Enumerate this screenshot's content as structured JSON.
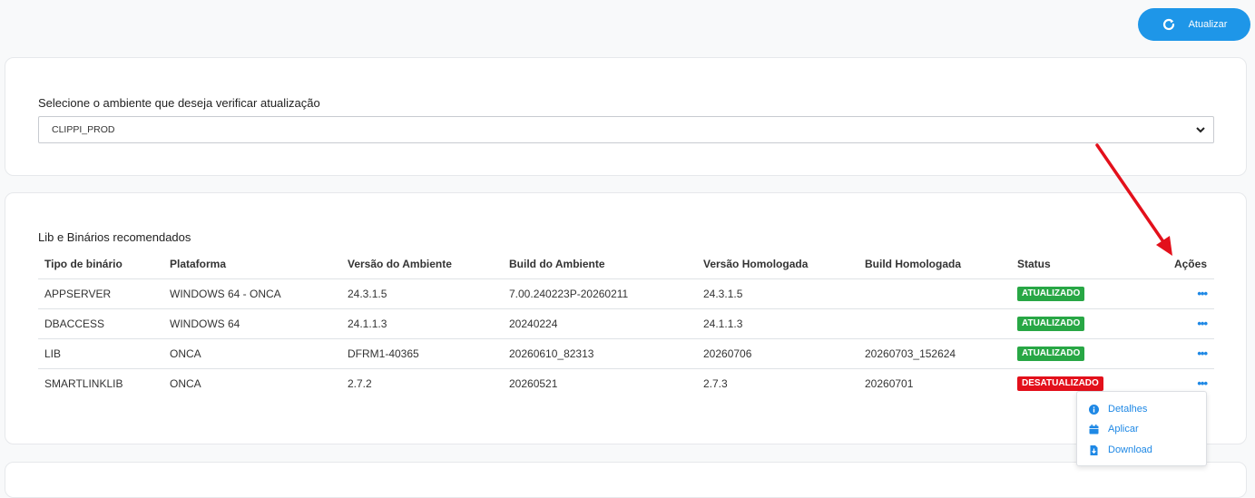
{
  "toolbar": {
    "refresh_label": "Atualizar",
    "refresh_icon": "refresh-icon"
  },
  "environment": {
    "label": "Selecione o ambiente que deseja verificar atualização",
    "selected": "CLIPPI_PROD"
  },
  "binaries": {
    "title": "Lib e Binários recomendados",
    "columns": [
      "Tipo de binário",
      "Plataforma",
      "Versão do Ambiente",
      "Build do Ambiente",
      "Versão Homologada",
      "Build Homologada",
      "Status",
      "Ações"
    ],
    "rows": [
      {
        "type": "APPSERVER",
        "platform": "WINDOWS 64 - ONCA",
        "env_version": "24.3.1.5",
        "env_build": "7.00.240223P-20260211",
        "approved_version": "24.3.1.5",
        "approved_build": "",
        "status": "ATUALIZADO",
        "status_kind": "ok"
      },
      {
        "type": "DBACCESS",
        "platform": "WINDOWS 64",
        "env_version": "24.1.1.3",
        "env_build": "20240224",
        "approved_version": "24.1.1.3",
        "approved_build": "",
        "status": "ATUALIZADO",
        "status_kind": "ok"
      },
      {
        "type": "LIB",
        "platform": "ONCA",
        "env_version": "DFRM1-40365",
        "env_build": "20260610_82313",
        "approved_version": "20260706",
        "approved_build": "20260703_152624",
        "status": "ATUALIZADO",
        "status_kind": "ok"
      },
      {
        "type": "SMARTLINKLIB",
        "platform": "ONCA",
        "env_version": "2.7.2",
        "env_build": "20260521",
        "approved_version": "2.7.3",
        "approved_build": "20260701",
        "status": "DESATUALIZADO",
        "status_kind": "bad"
      }
    ],
    "actions_label": "•••"
  },
  "actions_menu": {
    "items": [
      {
        "label": "Detalhes",
        "icon": "info-icon"
      },
      {
        "label": "Aplicar",
        "icon": "calendar-icon"
      },
      {
        "label": "Download",
        "icon": "file-download-icon"
      }
    ]
  },
  "colors": {
    "accent": "#1e96e8",
    "link": "#1e88e5",
    "ok": "#28a745",
    "bad": "#e3101b",
    "annotation_arrow": "#e3101b"
  }
}
